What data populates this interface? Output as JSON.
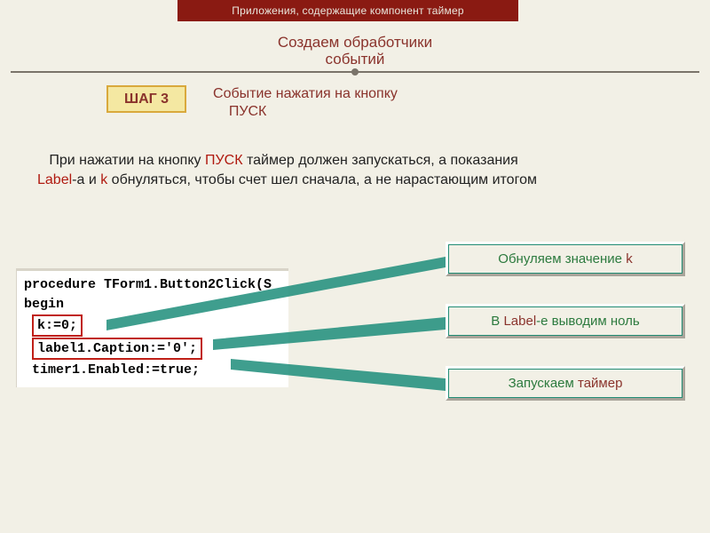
{
  "banner": "Приложения, содержащие компонент таймер",
  "section_title_line1": "Создаем обработчики",
  "section_title_line2": "событий",
  "step": {
    "label": "ШАГ 3",
    "caption_line1": "Событие нажатия на кнопку",
    "caption_line2": "ПУСК"
  },
  "desc": {
    "p1a": "При нажатии на кнопку ",
    "p1b": "ПУСК",
    "p1c": " таймер должен запускаться, а показания ",
    "p2a": "Label",
    "p2b": "-a и ",
    "p2c": "k",
    "p2d": " обнуляться, чтобы счет шел сначала, а не нарастающим итогом"
  },
  "code": {
    "l1": "procedure TForm1.Button2Click(S",
    "l2": "begin",
    "l3": "k:=0;",
    "l4": "label1.Caption:='0';",
    "l5": "timer1.Enabled:=true;"
  },
  "callouts": {
    "c1_a": "Обнуляем значение ",
    "c1_b": "k",
    "c2_a": "В ",
    "c2_b": "Label",
    "c2_c": "-е выводим ноль",
    "c3_a": "Запускаем ",
    "c3_b": "таймер"
  }
}
